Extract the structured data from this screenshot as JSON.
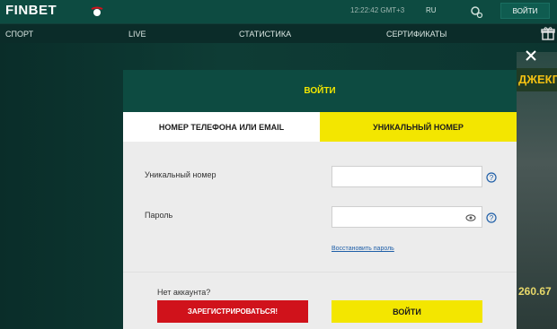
{
  "header": {
    "logo": "FINBET",
    "time": "12:22:42 GMT+3",
    "language": "RU",
    "login_label": "ВОЙТИ"
  },
  "nav": {
    "items": [
      {
        "label": "СПОРТ"
      },
      {
        "label": "LIVE"
      },
      {
        "label": "СТАТИСТИКА"
      },
      {
        "label": "СЕРТИФИКАТЫ"
      }
    ]
  },
  "background": {
    "promo_text": "ДЖЕКП",
    "promo_amount": "260.67"
  },
  "modal": {
    "title": "ВОЙТИ",
    "tabs": [
      {
        "label": "НОМЕР ТЕЛЕФОНА ИЛИ EMAIL",
        "active": false
      },
      {
        "label": "УНИКАЛЬНЫЙ НОМЕР",
        "active": true
      }
    ],
    "unique_number_label": "Уникальный номер",
    "unique_number_value": "",
    "password_label": "Пароль",
    "password_value": "",
    "restore_password": "Восстановить пароль",
    "no_account": "Нет аккаунта?",
    "register_label": "ЗАРЕГИСТРИРОВАТЬСЯ!",
    "submit_label": "ВОЙТИ"
  },
  "colors": {
    "brand_green": "#0d4b41",
    "accent_yellow": "#f3e600",
    "register_red": "#d0121b"
  },
  "icons": [
    "ball-logo-icon",
    "settings-icon",
    "gift-icon",
    "close-icon",
    "help-icon",
    "eye-icon"
  ]
}
